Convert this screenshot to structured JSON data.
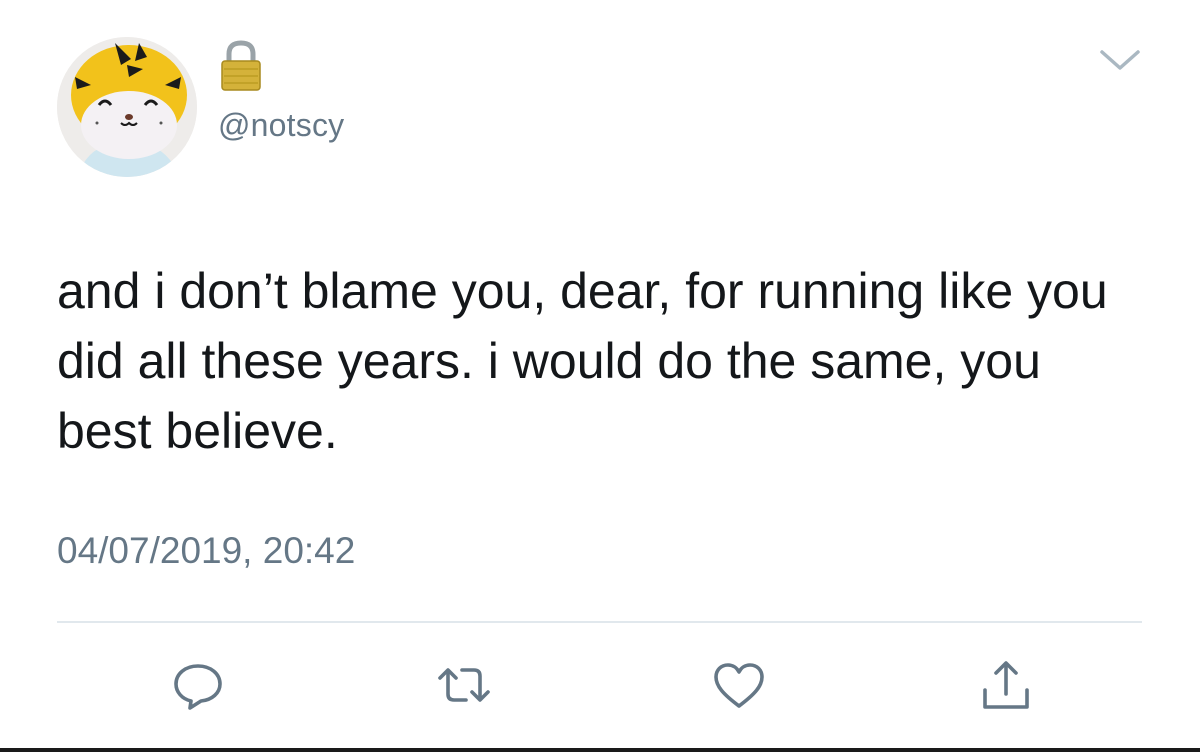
{
  "tweet": {
    "handle": "@notscy",
    "protected": true,
    "text": "and i don’t blame you, dear, for running like you did all these years. i would do the same, you best believe.",
    "timestamp": "04/07/2019, 20:42"
  },
  "icons": {
    "avatar": "tiger-avatar",
    "lock": "lock-icon",
    "menu": "chevron-down-icon",
    "reply": "reply-icon",
    "retweet": "retweet-icon",
    "like": "heart-icon",
    "share": "share-icon"
  },
  "colors": {
    "text": "#14171a",
    "secondary": "#657786",
    "divider": "#e1e8ed",
    "action_icons": "#657786",
    "lock_gold": "#d4b23a"
  }
}
